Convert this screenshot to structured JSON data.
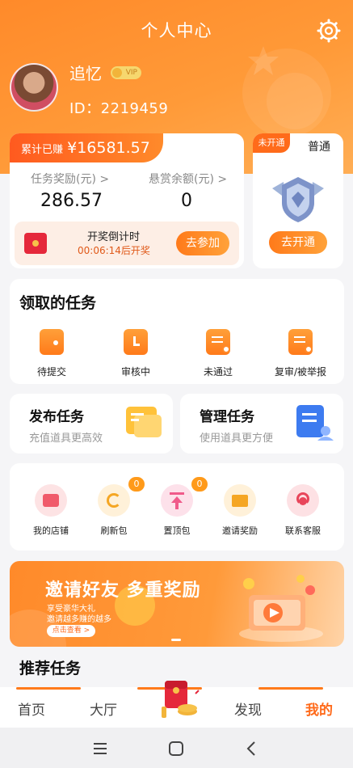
{
  "header": {
    "title": "个人中心",
    "username": "追忆",
    "vip_badge": "VIP",
    "user_id": "ID：2219459"
  },
  "earnings": {
    "total_label": "累计已赚",
    "total_value": "¥16581.57",
    "reward_label": "任务奖励(元) >",
    "reward_value": "286.57",
    "bounty_label": "悬赏余额(元) >",
    "bounty_value": "0",
    "countdown_title": "开奖倒计时",
    "countdown_time": "00:06:14后开奖",
    "join_button": "去参加"
  },
  "membership": {
    "status_tag": "未开通",
    "level": "普通",
    "open_button": "去开通"
  },
  "received_tasks": {
    "title": "领取的任务",
    "items": [
      {
        "label": "待提交",
        "icon": "wallet-icon"
      },
      {
        "label": "审核中",
        "icon": "clock-icon"
      },
      {
        "label": "未通过",
        "icon": "reject-doc-icon"
      },
      {
        "label": "复审/被举报",
        "icon": "review-doc-icon"
      }
    ]
  },
  "publish": {
    "title": "发布任务",
    "subtitle": "充值道具更高效"
  },
  "manage": {
    "title": "管理任务",
    "subtitle": "使用道具更方便"
  },
  "tools": {
    "items": [
      {
        "label": "我的店铺",
        "icon": "shop-icon",
        "color": "#f05a6a"
      },
      {
        "label": "刷新包",
        "icon": "refresh-icon",
        "color": "#f5a623",
        "badge": "0"
      },
      {
        "label": "置顶包",
        "icon": "pin-top-icon",
        "color": "#f05a8a",
        "badge": "0"
      },
      {
        "label": "邀请奖励",
        "icon": "envelope-icon",
        "color": "#f5a623"
      },
      {
        "label": "联系客服",
        "icon": "headset-icon",
        "color": "#e8455a"
      }
    ]
  },
  "promo": {
    "title": "邀请好友 多重奖励",
    "line1": "享受豪华大礼",
    "line2": "邀请越多赚的越多",
    "button": "点击查看 >"
  },
  "recommend": {
    "title": "推荐任务"
  },
  "bottom_nav": {
    "items": [
      "首页",
      "大厅",
      "发现",
      "我的"
    ],
    "active_index": 3
  },
  "colors": {
    "accent": "#ff7a1a",
    "header_gradient_start": "#ff8a2a",
    "header_gradient_end": "#ffae55"
  }
}
